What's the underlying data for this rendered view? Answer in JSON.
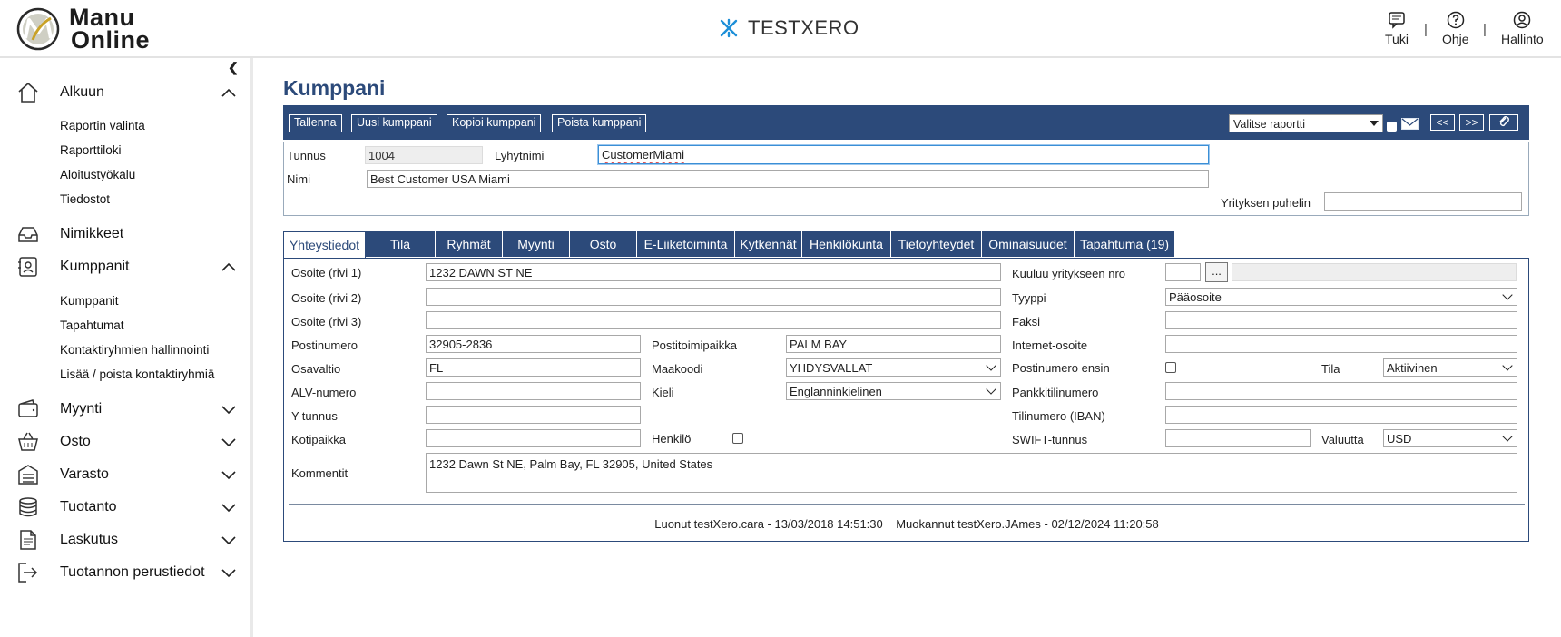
{
  "header": {
    "logo_line1": "Manu",
    "logo_line2": "Online",
    "company": "TESTXERO",
    "support_label": "Tuki",
    "help_label": "Ohje",
    "admin_label": "Hallinto",
    "separator": "|"
  },
  "sidebar": {
    "sections": [
      {
        "label": "Alkuun",
        "icon": "home-icon",
        "expanded": true
      },
      {
        "label": "Nimikkeet",
        "icon": "inbox-icon"
      },
      {
        "label": "Kumppanit",
        "icon": "contact-card-icon",
        "expanded": true
      },
      {
        "label": "Myynti",
        "icon": "wallet-icon",
        "expanded": false
      },
      {
        "label": "Osto",
        "icon": "basket-icon",
        "expanded": false
      },
      {
        "label": "Varasto",
        "icon": "warehouse-icon",
        "expanded": false
      },
      {
        "label": "Tuotanto",
        "icon": "database-icon",
        "expanded": false
      },
      {
        "label": "Laskutus",
        "icon": "invoice-icon",
        "expanded": false
      },
      {
        "label": "Tuotannon perustiedot",
        "icon": "exit-icon",
        "expanded": false
      }
    ],
    "alkuun_items": [
      "Raportin valinta",
      "Raporttiloki",
      "Aloitustyökalu",
      "Tiedostot"
    ],
    "kumppanit_items": [
      "Kumppanit",
      "Tapahtumat",
      "Kontaktiryhmien hallinnointi",
      "Lisää / poista kontaktiryhmiä"
    ]
  },
  "page": {
    "title": "Kumppani",
    "toolbar": {
      "save": "Tallenna",
      "new": "Uusi kumppani",
      "copy": "Kopioi kumppani",
      "delete": "Poista kumppani",
      "report_select": "Valitse raportti",
      "prev": "<<",
      "next": ">>"
    },
    "top_form": {
      "id_label": "Tunnus",
      "id_value": "1004",
      "short_name_label": "Lyhytnimi",
      "short_name_value": "CustomerMiami",
      "name_label": "Nimi",
      "name_value": "Best Customer USA Miami",
      "company_phone_label": "Yrityksen puhelin",
      "company_phone_value": ""
    },
    "tabs": [
      "Yhteystiedot",
      "Tila",
      "Ryhmät",
      "Myynti",
      "Osto",
      "E-Liiketoiminta",
      "Kytkennät",
      "Henkilökunta",
      "Tietoyhteydet",
      "Ominaisuudet",
      "Tapahtuma (19)"
    ],
    "contact": {
      "addr1_label": "Osoite (rivi 1)",
      "addr1_value": "1232 DAWN ST NE",
      "addr2_label": "Osoite (rivi 2)",
      "addr2_value": "",
      "addr3_label": "Osoite (rivi 3)",
      "addr3_value": "",
      "postal_label": "Postinumero",
      "postal_value": "32905-2836",
      "city_label": "Postitoimipaikka",
      "city_value": "PALM BAY",
      "state_label": "Osavaltio",
      "state_value": "FL",
      "country_label": "Maakoodi",
      "country_value": "YHDYSVALLAT",
      "vat_label": "ALV-numero",
      "vat_value": "",
      "lang_label": "Kieli",
      "lang_value": "Englanninkielinen",
      "ytunnus_label": "Y-tunnus",
      "ytunnus_value": "",
      "domicile_label": "Kotipaikka",
      "domicile_value": "",
      "person_label": "Henkilö",
      "comments_label": "Kommentit",
      "comments_value": "1232 Dawn St NE, Palm Bay, FL 32905, United States",
      "parent_label": "Kuuluu yritykseen nro",
      "parent_button": "...",
      "type_label": "Tyyppi",
      "type_value": "Pääosoite",
      "fax_label": "Faksi",
      "fax_value": "",
      "web_label": "Internet-osoite",
      "web_value": "",
      "postal_first_label": "Postinumero ensin",
      "status_label": "Tila",
      "status_value": "Aktiivinen",
      "bank_label": "Pankkitilinumero",
      "bank_value": "",
      "iban_label": "Tilinumero (IBAN)",
      "iban_value": "",
      "swift_label": "SWIFT-tunnus",
      "swift_value": "",
      "currency_label": "Valuutta",
      "currency_value": "USD"
    },
    "footer": "Luonut testXero.cara - 13/03/2018 14:51:30    Muokannut testXero.JAmes - 02/12/2024 11:20:58"
  },
  "colors": {
    "brand": "#2c4a7a",
    "accent_logo": "#c9a227"
  }
}
